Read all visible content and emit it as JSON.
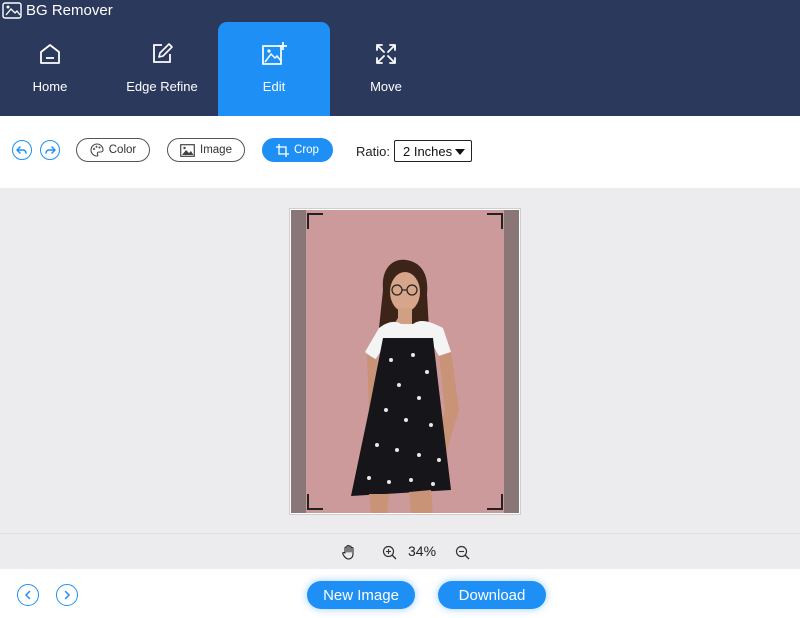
{
  "app": {
    "title": "BG Remover"
  },
  "nav": {
    "tabs": [
      {
        "label": "Home",
        "icon": "home-icon"
      },
      {
        "label": "Edge Refine",
        "icon": "edit-pen-icon"
      },
      {
        "label": "Edit",
        "icon": "image-plus-icon",
        "active": true
      },
      {
        "label": "Move",
        "icon": "move-arrows-icon"
      }
    ]
  },
  "toolbar": {
    "color_label": "Color",
    "image_label": "Image",
    "crop_label": "Crop",
    "ratio_label": "Ratio:",
    "ratio_value": "2 Inches"
  },
  "zoom": {
    "value": "34%"
  },
  "footer": {
    "new_image_label": "New Image",
    "download_label": "Download"
  },
  "colors": {
    "header_bg": "#2b3a5c",
    "accent": "#1e90f5",
    "canvas_bg": "#ececee",
    "photo_bg": "#cc9a9a"
  }
}
